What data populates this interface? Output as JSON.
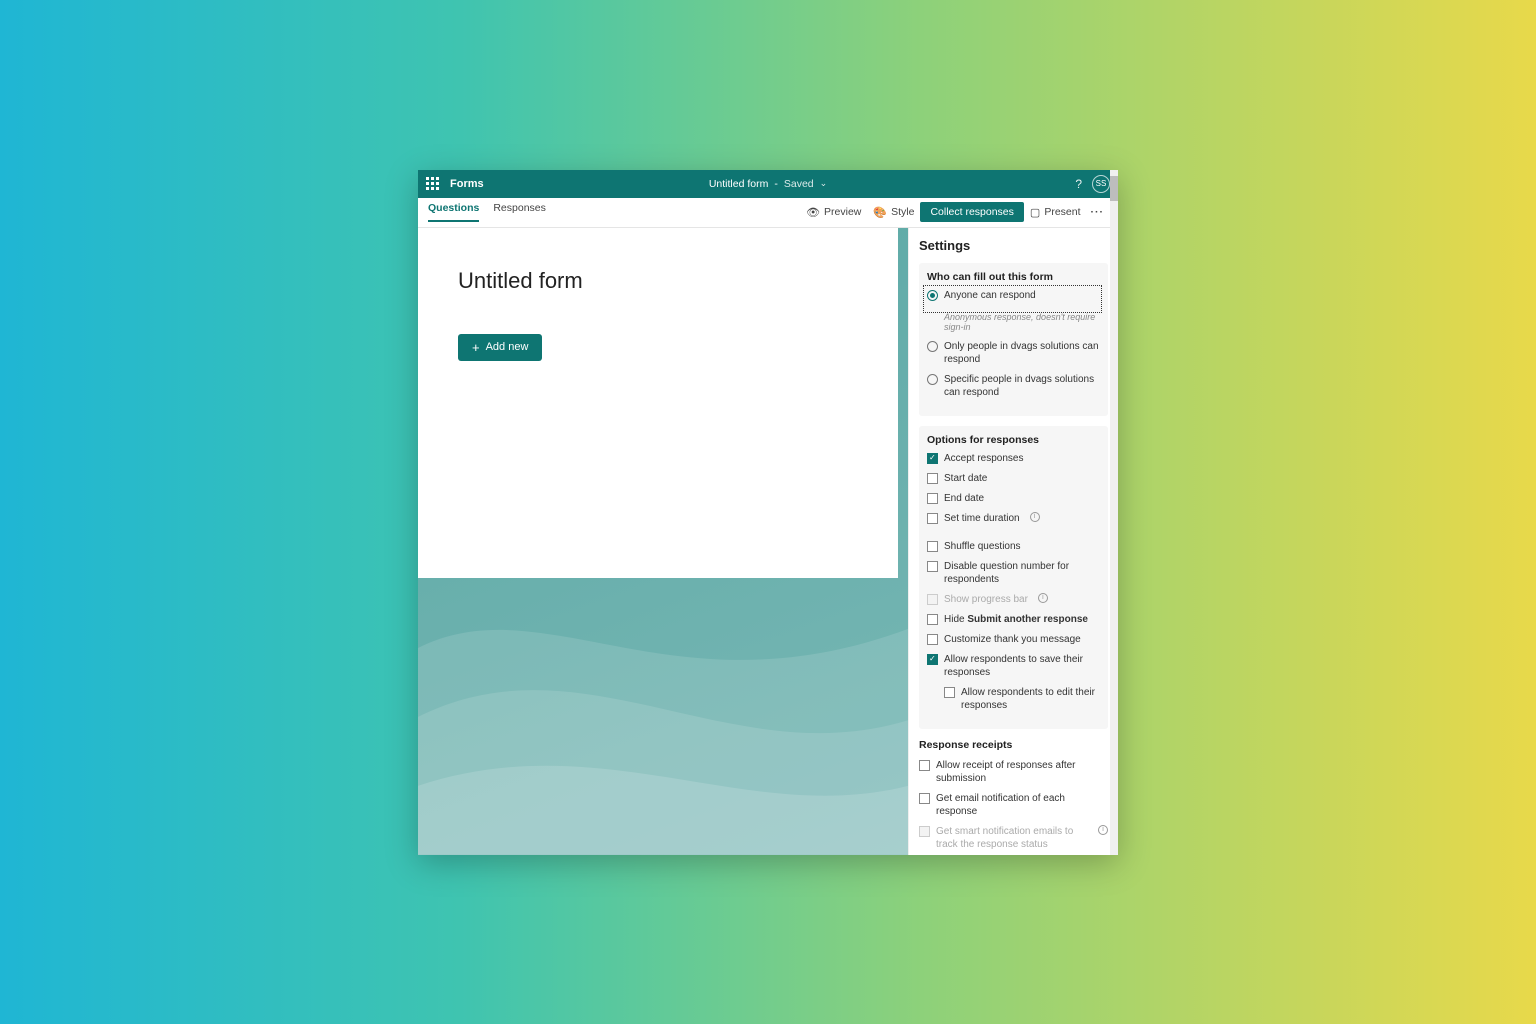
{
  "header": {
    "app_name": "Forms",
    "doc_name": "Untitled form",
    "status": "Saved",
    "avatar_initials": "SS"
  },
  "toolbar": {
    "tabs": [
      "Questions",
      "Responses"
    ],
    "active_tab": 0,
    "preview": "Preview",
    "style": "Style",
    "collect": "Collect responses",
    "present": "Present"
  },
  "form": {
    "title": "Untitled form",
    "add_new": "Add new"
  },
  "settings": {
    "title": "Settings",
    "who_title": "Who can fill out this form",
    "who_options": [
      {
        "label": "Anyone can respond",
        "selected": true,
        "note": "Anonymous response, doesn't require sign-in"
      },
      {
        "label": "Only people in dvags solutions can respond",
        "selected": false
      },
      {
        "label": "Specific people in dvags solutions can respond",
        "selected": false
      }
    ],
    "options_title": "Options for responses",
    "opt_accept": "Accept responses",
    "opt_start": "Start date",
    "opt_end": "End date",
    "opt_duration": "Set time duration",
    "opt_shuffle": "Shuffle questions",
    "opt_disable_num": "Disable question number for respondents",
    "opt_progress": "Show progress bar",
    "opt_hide_submit_pre": "Hide ",
    "opt_hide_submit_bold": "Submit another response",
    "opt_thankyou": "Customize thank you message",
    "opt_allow_save": "Allow respondents to save their responses",
    "opt_allow_edit": "Allow respondents to edit their responses",
    "receipts_title": "Response receipts",
    "rcpt_allow": "Allow receipt of responses after submission",
    "rcpt_email": "Get email notification of each response",
    "rcpt_smart": "Get smart notification emails to track the response status"
  }
}
